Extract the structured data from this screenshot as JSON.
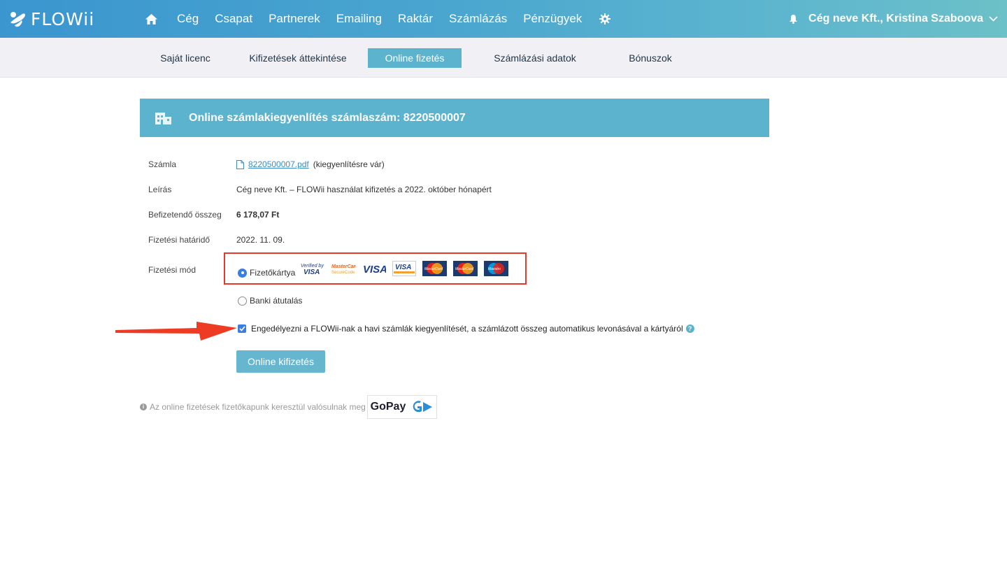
{
  "brand": {
    "name": "FLOWii"
  },
  "nav": {
    "items": [
      "Cég",
      "Csapat",
      "Partnerek",
      "Emailing",
      "Raktár",
      "Számlázás",
      "Pénzügyek"
    ],
    "user": "Cég neve Kft., Kristina Szaboova"
  },
  "subnav": {
    "tabs": [
      "Saját licenc",
      "Kifizetések áttekintése",
      "Online fizetés",
      "Számlázási adatok",
      "Bónuszok"
    ],
    "active": "Online fizetés"
  },
  "banner": {
    "title": "Online számlakiegyenlítés számlaszám: 8220500007"
  },
  "details": {
    "invoice_label": "Számla",
    "invoice_file": "8220500007.pdf",
    "invoice_status": "(kiegyenlítésre vár)",
    "description_label": "Leírás",
    "description_value": "Cég neve Kft. – FLOWii használat kifizetés a 2022. október hónapért",
    "amount_label": "Befizetendő összeg",
    "amount_value": "6 178,07 Ft",
    "deadline_label": "Fizetési határidő",
    "deadline_value": "2022. 11. 09.",
    "method_label": "Fizetési mód"
  },
  "payment_methods": {
    "card_label": "Fizetőkártya",
    "card_selected": true,
    "bank_label": "Banki átutalás",
    "bank_selected": false,
    "card_logos": [
      "Verified by VISA",
      "MasterCard SecureCode",
      "VISA",
      "VISA Electron",
      "MasterCard",
      "MasterCard",
      "Maestro"
    ]
  },
  "autopay": {
    "label": "Engedélyezni a FLOWii-nak a havi számlák kiegyenlítését, a számlázott összeg automatikus levonásával a kártyáról",
    "checked": true
  },
  "actions": {
    "pay_button": "Online kifizetés"
  },
  "footer": {
    "note": "Az online fizetések fizetőkapunk keresztül valósulnak meg",
    "gateway": "GoPay"
  },
  "colors": {
    "accent": "#5cb3ce",
    "highlight": "#e33a2c",
    "checkbox": "#3b7de0"
  }
}
